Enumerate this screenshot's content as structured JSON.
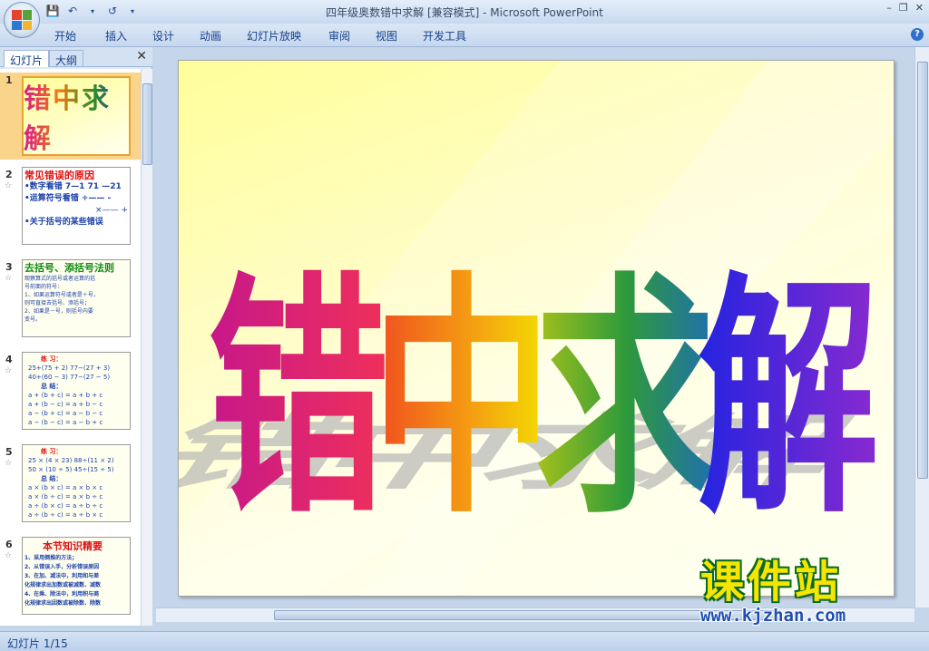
{
  "app": {
    "window_title": "四年级奥数错中求解 [兼容模式] - Microsoft PowerPoint"
  },
  "ribbon": {
    "tabs": [
      "开始",
      "插入",
      "设计",
      "动画",
      "幻灯片放映",
      "审阅",
      "视图",
      "开发工具"
    ]
  },
  "left_pane": {
    "tab_slides": "幻灯片",
    "tab_outline": "大纲",
    "thumbnails": [
      {
        "num": "1",
        "lines": [
          "错中求解"
        ]
      },
      {
        "num": "2",
        "lines": [
          "常见错误的原因",
          "•数字看错 7—1  71 —21",
          "•运算符号看错 ÷—— -",
          "×—— +",
          "•关于括号的某些错误"
        ]
      },
      {
        "num": "3",
        "lines": [
          "去括号、添括号法则",
          "观察算式的括号或者运算的括",
          "号前面的符号：",
          "1、如果运算符号或者是＋号，",
          "则可直接去括号、添括号；",
          "2、如果是－号，则括号内要",
          "变号。"
        ]
      },
      {
        "num": "4",
        "lines": [
          "练  习：",
          "25+(75 + 2)  77−(27 + 3)",
          "40+(60 − 3)  77−(27 − 5)",
          "总  结：",
          "a + (b + c) = a + b + c",
          "a + (b − c) = a + b − c",
          "a − (b + c) = a − b − c",
          "a − (b − c) = a − b + c"
        ]
      },
      {
        "num": "5",
        "lines": [
          "练  习：",
          "25 × (4 × 23)  88÷(11 × 2)",
          "50 × (10 ÷ 5)  45÷(15 ÷ 5)",
          "总  结：",
          "a × (b × c) = a × b × c",
          "a × (b ÷ c) = a × b ÷ c",
          "a ÷ (b × c) = a ÷ b ÷ c",
          "a ÷ (b ÷ c) = a ÷ b × c"
        ]
      },
      {
        "num": "6",
        "lines": [
          "本节知识精要",
          "1、采用倒推的方法；",
          "2、从错误入手，分析错误原因",
          "3、在加、减法中，利用和与差",
          "化规律求出加数或被减数、减数",
          "4、在乘、除法中，利用积与商",
          "化规律求出因数或被除数、除数"
        ]
      }
    ]
  },
  "slide": {
    "title_chars": [
      "错",
      "中",
      "求",
      "解"
    ]
  },
  "status": {
    "slide_info": "幻灯片 1/15"
  },
  "watermark": {
    "title": "课件站",
    "url": "www.kjzhan.com"
  },
  "colors": {
    "char1": "#d81b8c",
    "char2": "#f07a10",
    "char3": "#2e8b2e",
    "char4": "#2a2ad8"
  }
}
